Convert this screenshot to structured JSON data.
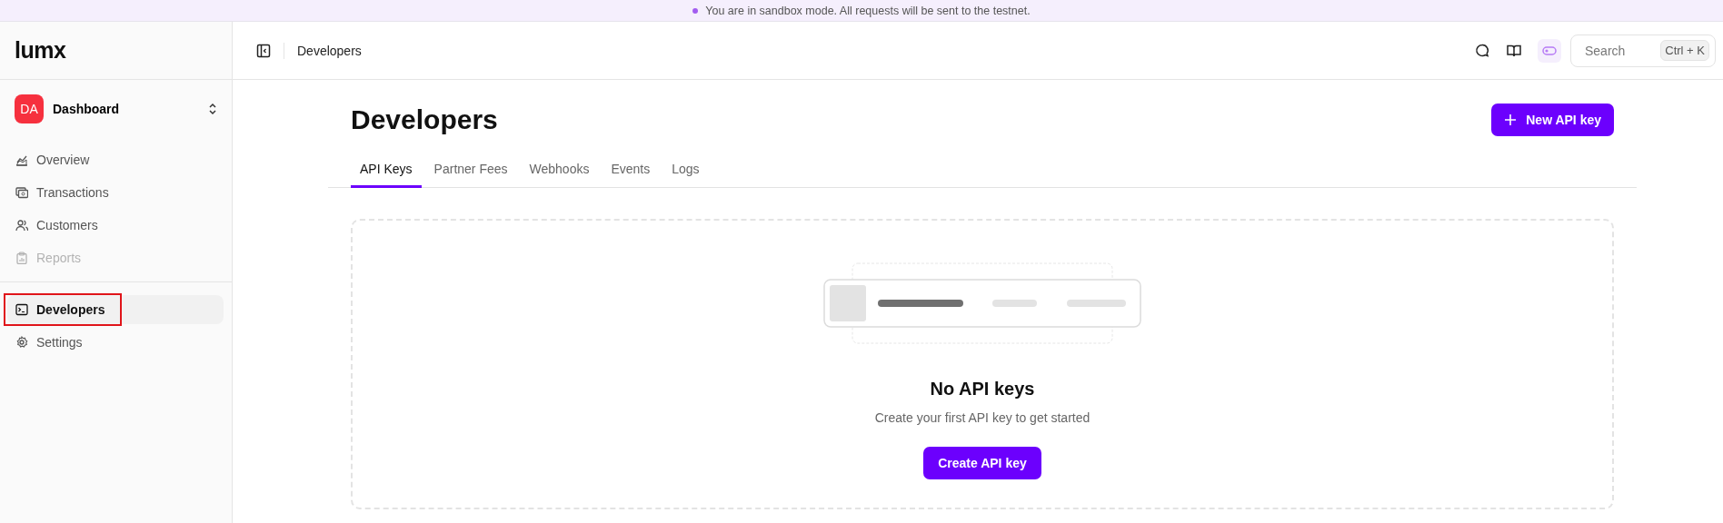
{
  "banner": {
    "text": "You are in sandbox mode. All requests will be sent to the testnet."
  },
  "sidebar": {
    "logo": "lumx",
    "workspace": {
      "initials": "DA",
      "name": "Dashboard"
    },
    "items": [
      {
        "label": "Overview",
        "selected": false,
        "disabled": false
      },
      {
        "label": "Transactions",
        "selected": false,
        "disabled": false
      },
      {
        "label": "Customers",
        "selected": false,
        "disabled": false
      },
      {
        "label": "Reports",
        "selected": false,
        "disabled": true
      }
    ],
    "bottom_items": [
      {
        "label": "Developers",
        "selected": true,
        "highlighted": true
      },
      {
        "label": "Settings",
        "selected": false
      }
    ]
  },
  "header": {
    "breadcrumb": "Developers",
    "search": {
      "placeholder": "Search",
      "shortcut": "Ctrl + K"
    }
  },
  "page": {
    "title": "Developers",
    "primary_button": "New API key",
    "tabs": [
      {
        "label": "API Keys",
        "selected": true
      },
      {
        "label": "Partner Fees",
        "selected": false
      },
      {
        "label": "Webhooks",
        "selected": false
      },
      {
        "label": "Events",
        "selected": false
      },
      {
        "label": "Logs",
        "selected": false
      }
    ],
    "empty_state": {
      "title": "No API keys",
      "description": "Create your first API key to get started",
      "button": "Create API key"
    }
  }
}
